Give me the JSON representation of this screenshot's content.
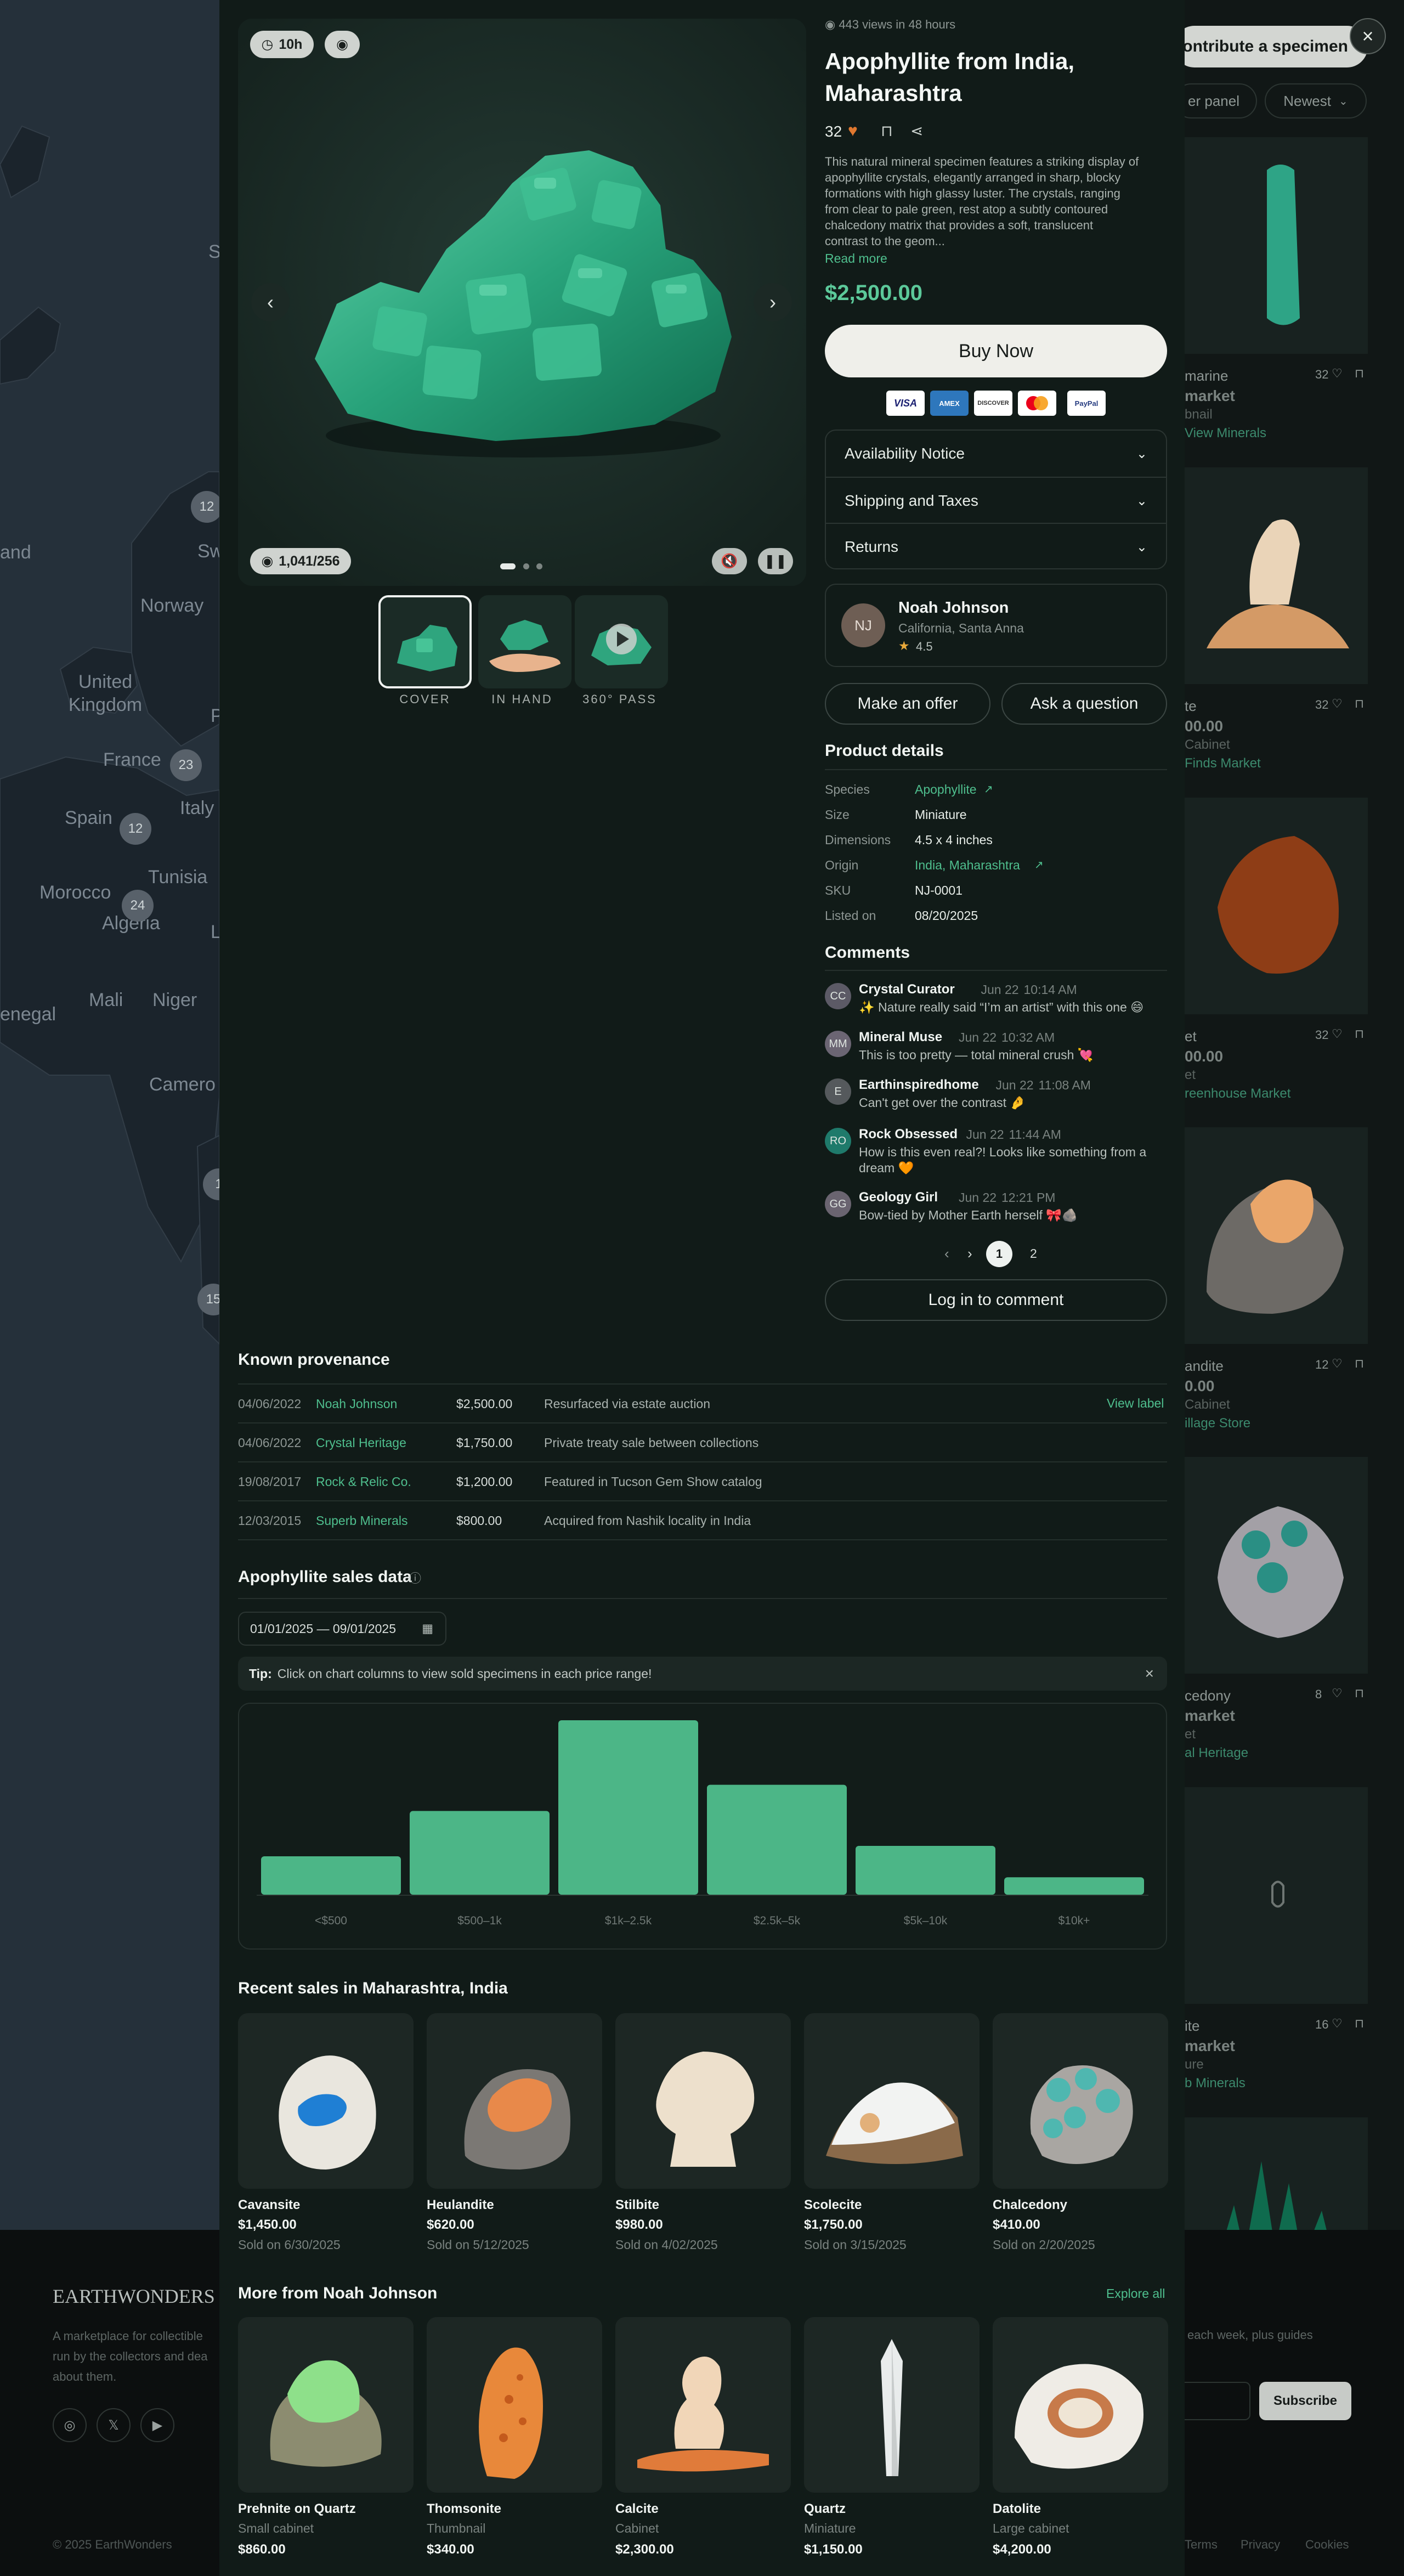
{
  "background": {
    "map_labels": [
      "and",
      "Norway",
      "United Kingdom",
      "France",
      "Spain",
      "Italy",
      "Tunisia",
      "Morocco",
      "Algeria",
      "Mali",
      "Niger",
      "enegal",
      "Camero",
      "Sw",
      "P",
      "S",
      "L"
    ],
    "map_clusters": [
      "12",
      "23",
      "12",
      "24",
      "1",
      "15"
    ],
    "toolbar": {
      "contribute_label": "Contribute a specimen",
      "filter_label": "er panel",
      "sort_label": "Newest"
    },
    "list_cards": [
      {
        "title": "marine",
        "likes": "32",
        "line2": "market",
        "line3": "bnail",
        "line4": "View Minerals"
      },
      {
        "title": "te",
        "likes": "32",
        "price": "00.00",
        "line3": "Cabinet",
        "line4": "Finds Market"
      },
      {
        "title": "et",
        "likes": "32",
        "price": "00.00",
        "line3": "et",
        "line4": "reenhouse Market"
      },
      {
        "title": "andite",
        "likes": "12",
        "price": "0.00",
        "line3": "Cabinet",
        "line4": "illage Store"
      },
      {
        "title": "cedony",
        "likes": "8",
        "line2": "market",
        "line3": "et",
        "line4": "al Heritage"
      },
      {
        "title": "ite",
        "likes": "16",
        "line2": "market",
        "line3": "ure",
        "line4": "b Minerals"
      }
    ],
    "footer": {
      "logo": "EARTHWONDERS",
      "tagline_lines": [
        "A marketplace for collectible",
        "run by the collectors and dea",
        "about them."
      ],
      "newsletter_text": "each week, plus guides",
      "subscribe_label": "Subscribe",
      "copyright": "© 2025 EarthWonders",
      "links": [
        "Terms",
        "Privacy",
        "Cookies"
      ]
    }
  },
  "gallery": {
    "time_badge": "10h",
    "views_count": "1,041/256",
    "thumbnails": [
      "COVER",
      "IN HAND",
      "360° PASS"
    ]
  },
  "product": {
    "views_note": "443 views in 48 hours",
    "title_line1": "Apophyllite from India,",
    "title_line2": "Maharashtra",
    "likes": "32",
    "description_lines": [
      "This natural mineral specimen features a striking display of",
      "apophyllite crystals, elegantly arranged in sharp, blocky",
      "formations with high glassy luster. The crystals, ranging",
      "from clear to pale green, rest atop a subtly contoured",
      "chalcedony matrix that provides a soft, translucent",
      "contrast to the geom..."
    ],
    "read_more": "Read more",
    "price": "$2,500.00",
    "buy_label": "Buy Now",
    "payment_methods": [
      "VISA",
      "AMEX",
      "DISCOVER",
      "Mastercard",
      "PayPal"
    ],
    "accordion": [
      "Availability Notice",
      "Shipping and Taxes",
      "Returns"
    ]
  },
  "seller": {
    "initials": "NJ",
    "name": "Noah Johnson",
    "location": "California, Santa Anna",
    "rating": "4.5"
  },
  "actions": {
    "offer_label": "Make an offer",
    "question_label": "Ask a question"
  },
  "details": {
    "title": "Product details",
    "rows": [
      {
        "label": "Species",
        "value": "Apophyllite"
      },
      {
        "label": "Size",
        "value": "Miniature"
      },
      {
        "label": "Dimensions",
        "value": "4.5 x 4 inches"
      },
      {
        "label": "Origin",
        "value": "India, Maharashtra"
      },
      {
        "label": "SKU",
        "value": "NJ-0001"
      },
      {
        "label": "Listed on",
        "value": "08/20/2025"
      }
    ]
  },
  "comments": {
    "title": "Comments",
    "items": [
      {
        "initials": "CC",
        "name": "Crystal Curator",
        "date": "Jun 22",
        "time": "10:14 AM",
        "text_lines": [
          "✨ Nature really said “I’m an artist” with this one 😄"
        ]
      },
      {
        "initials": "MM",
        "name": "Mineral Muse",
        "date": "Jun 22",
        "time": "10:32 AM",
        "text_lines": [
          "This is too pretty — total mineral crush 💘"
        ]
      },
      {
        "initials": "E",
        "name": "Earthinspiredhome",
        "date": "Jun 22",
        "time": "11:08 AM",
        "text_lines": [
          "Can't get over the contrast 🤌"
        ]
      },
      {
        "initials": "RO",
        "name": "Rock Obsessed",
        "date": "Jun 22",
        "time": "11:44 AM",
        "text_lines": [
          "How is this even real?! Looks like something from a",
          "dream 🧡"
        ]
      },
      {
        "initials": "GG",
        "name": "Geology Girl",
        "date": "Jun 22",
        "time": "12:21 PM",
        "text_lines": [
          "Bow-tied by Mother Earth herself 🎀🪨"
        ]
      }
    ],
    "pages": [
      "1",
      "2"
    ],
    "login_label": "Log in to comment"
  },
  "provenance": {
    "title": "Known provenance",
    "view_label": "View label",
    "rows": [
      {
        "date": "04/06/2022",
        "owner": "Noah Johnson",
        "price": "$2,500.00",
        "note": "Resurfaced via estate auction"
      },
      {
        "date": "04/06/2022",
        "owner": "Crystal Heritage",
        "price": "$1,750.00",
        "note": "Private treaty sale between collections"
      },
      {
        "date": "19/08/2017",
        "owner": "Rock & Relic Co.",
        "price": "$1,200.00",
        "note": "Featured in Tucson Gem Show catalog"
      },
      {
        "date": "12/03/2015",
        "owner": "Superb Minerals",
        "price": "$800.00",
        "note": "Acquired from Nashik locality in India"
      }
    ]
  },
  "sales": {
    "title": "Apophyllite sales data",
    "date_range": "01/01/2025 — 09/01/2025",
    "tip_label": "Tip:",
    "tip_text": "Click on chart columns to view sold specimens in each price range!"
  },
  "chart_data": {
    "type": "bar",
    "categories": [
      "<$500",
      "$500–1k",
      "$1k–2.5k",
      "$2.5k–5k",
      "$5k–10k",
      "$10k+"
    ],
    "values": [
      22,
      48,
      100,
      63,
      28,
      10
    ],
    "title": "",
    "xlabel": "",
    "ylabel": "",
    "grid": false,
    "color": "#4cb687"
  },
  "recent_sales": {
    "title": "Recent sales in Maharashtra, India",
    "items": [
      {
        "name": "Cavansite",
        "price": "$1,450.00",
        "sold": "Sold on 6/30/2025"
      },
      {
        "name": "Heulandite",
        "price": "$620.00",
        "sold": "Sold on 5/12/2025"
      },
      {
        "name": "Stilbite",
        "price": "$980.00",
        "sold": "Sold on 4/02/2025"
      },
      {
        "name": "Scolecite",
        "price": "$1,750.00",
        "sold": "Sold on 3/15/2025"
      },
      {
        "name": "Chalcedony",
        "price": "$410.00",
        "sold": "Sold on 2/20/2025"
      }
    ]
  },
  "more_from": {
    "title": "More from Noah Johnson",
    "explore_label": "Explore all",
    "items": [
      {
        "name": "Prehnite on Quartz",
        "size": "Small cabinet",
        "price": "$860.00"
      },
      {
        "name": "Thomsonite",
        "size": "Thumbnail",
        "price": "$340.00"
      },
      {
        "name": "Calcite",
        "size": "Cabinet",
        "price": "$2,300.00"
      },
      {
        "name": "Quartz",
        "size": "Miniature",
        "price": "$1,150.00"
      },
      {
        "name": "Datolite",
        "size": "Large cabinet",
        "price": "$4,200.00"
      }
    ]
  },
  "colors": {
    "accent_green": "#4fbf8e",
    "price_green": "#5cc99a",
    "heart": "#e0782f",
    "chart_bar": "#4cb687"
  }
}
